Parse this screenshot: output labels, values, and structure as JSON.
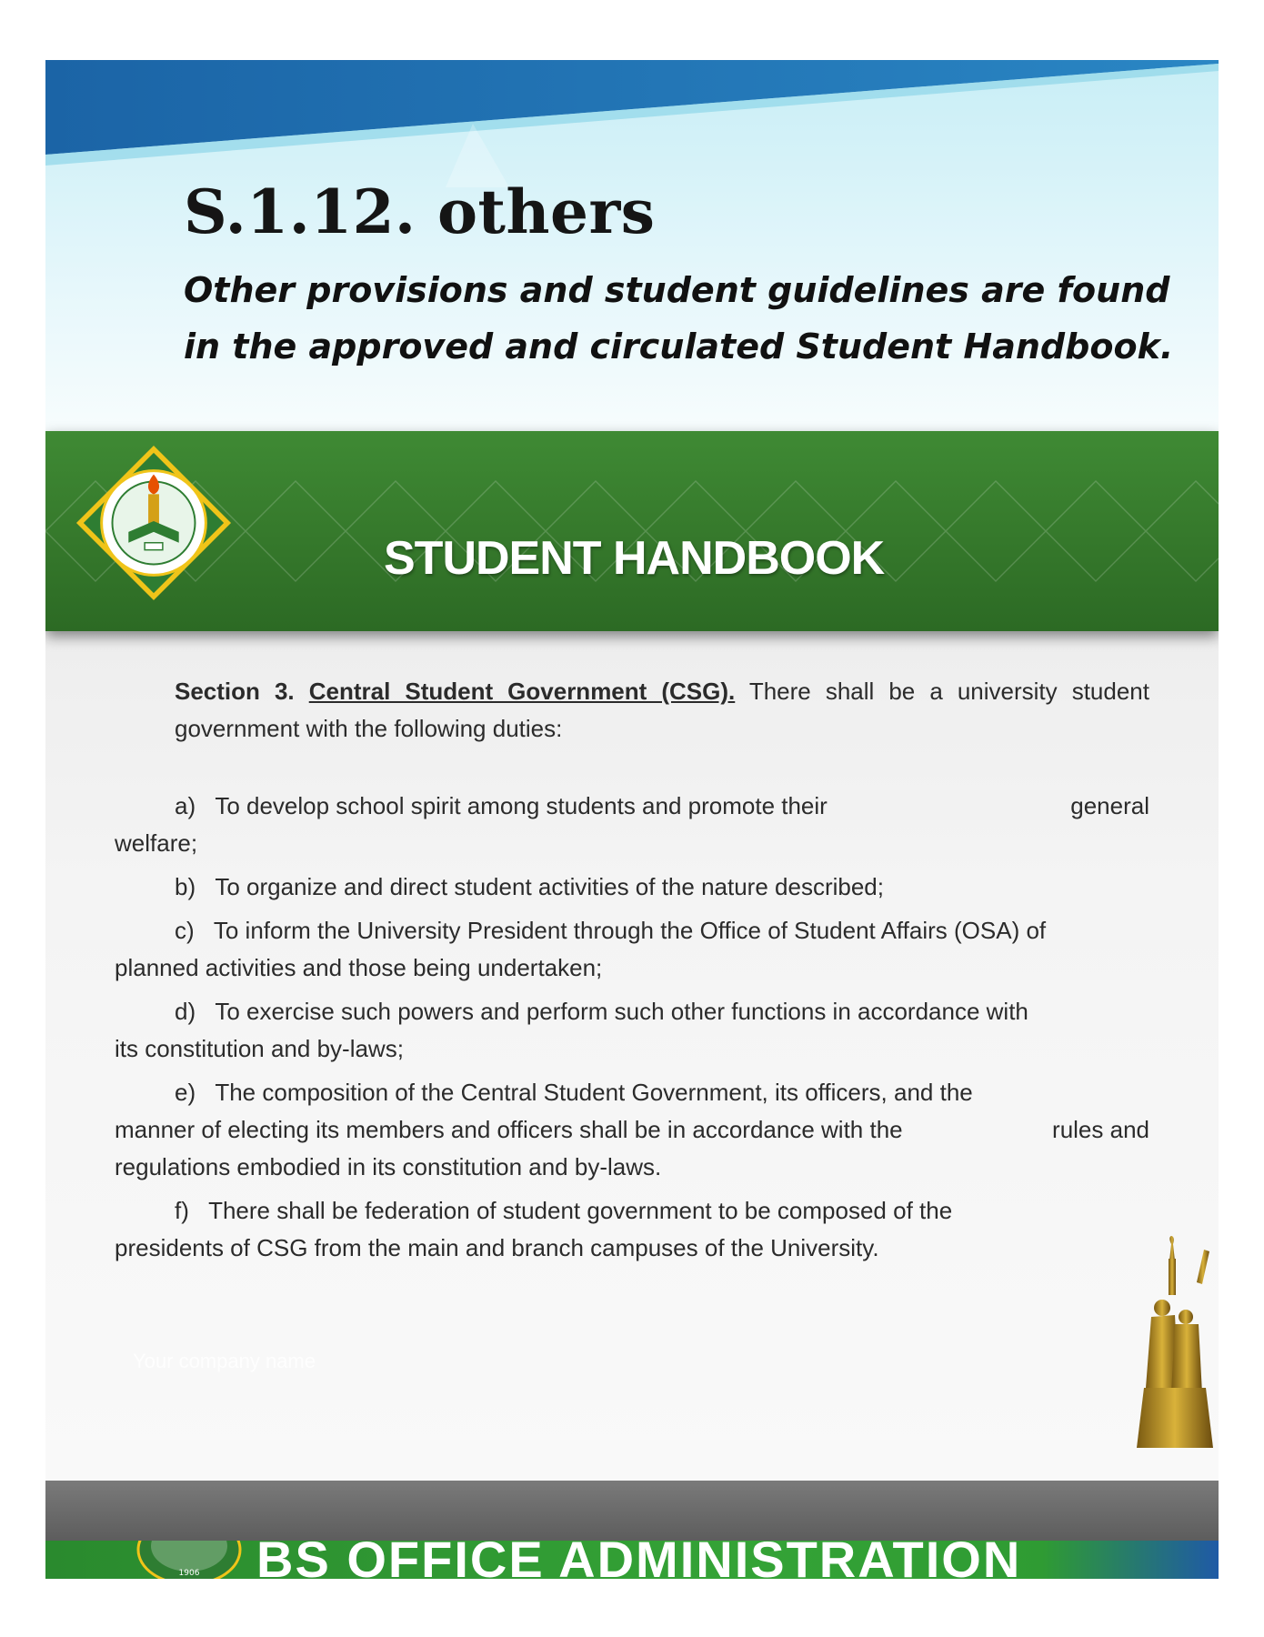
{
  "slide": {
    "heading": "S.1.12. others",
    "subheading_line1": "Other provisions and student guidelines are found",
    "subheading_line2": "in the approved and circulated Student Handbook."
  },
  "document": {
    "title": "STUDENT HANDBOOK",
    "section_label": "Section 3.",
    "section_title": "Central Student Government (CSG).",
    "section_intro": "There shall be a university student government with the following duties:",
    "items": [
      {
        "marker": "a)",
        "text": "To develop school spirit among students and promote their",
        "trailing": "general",
        "continuation": "welfare;"
      },
      {
        "marker": "b)",
        "text": "To organize and direct student activities of the nature described;"
      },
      {
        "marker": "c)",
        "text": "To inform the University President through the Office of Student Affairs (OSA) of",
        "continuation": "planned activities and those being undertaken;"
      },
      {
        "marker": "d)",
        "text": "To exercise such powers and perform such other functions in accordance with",
        "continuation": "its constitution and by-laws;"
      },
      {
        "marker": "e)",
        "text": "The composition of the Central Student Government, its officers, and the",
        "line2": "manner of electing its members and officers shall be in accordance with the",
        "line2_trailing": "rules and",
        "continuation": "regulations embodied in its constitution and by-laws."
      },
      {
        "marker": "f)",
        "text": "There shall be federation of student government to be composed of the",
        "continuation": "presidents of CSG from the main and branch campuses of the University."
      }
    ],
    "footer_placeholder": "Your company name"
  },
  "footer": {
    "program_name": "BS OFFICE ADMINISTRATION",
    "seal_year": "1906"
  },
  "colors": {
    "header_green": "#3a7f30",
    "bottom_green": "#34a336",
    "top_blue": "#1f6fb0",
    "gray_bar": "#6b6b6b"
  }
}
